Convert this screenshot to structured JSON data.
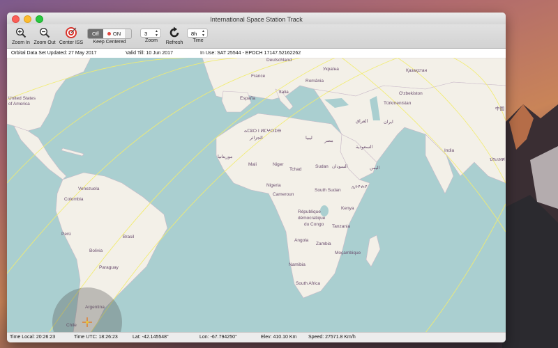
{
  "window": {
    "title": "International Space Station Track"
  },
  "toolbar": {
    "zoom_in_label": "Zoom In",
    "zoom_out_label": "Zoom Out",
    "center_label": "Center ISS",
    "keep_centered": {
      "label": "Keep Centered",
      "off": "Off",
      "on": "ON"
    },
    "zoom": {
      "label": "Zoom",
      "value": "3"
    },
    "refresh_label": "Refresh",
    "time": {
      "label": "Time",
      "value": "8h"
    }
  },
  "infobar": {
    "updated": "Orbital Data Set Updated:  27 May 2017",
    "valid": "Valid Till:  10 Jun 2017",
    "in_use": "In Use:  SAT 25544   -   EPOCH 17147.52162262"
  },
  "map": {
    "labels": [
      "Deutschland",
      "Україна",
      "Қазақстан",
      "France",
      "România",
      "United States",
      "of America",
      "Italia",
      "España",
      "O'zbekiston",
      "Türkmenistan",
      "ⴰⵎⵓⵔ ⵏ ⵍⵎⵖⵔⵉⴱ",
      "الجزائر",
      "ليبيا",
      "مصر",
      "العراق",
      "ایران",
      "السعودية",
      "India",
      "Mali",
      "Niger",
      "Tchad",
      "Sudan",
      "السودان",
      "اليمن",
      "Nigeria",
      "Cameroun",
      "South Sudan",
      "ኢትዮጵያ",
      "Venezuela",
      "Colombia",
      "République",
      "démocratique",
      "du Congo",
      "Kenya",
      "Tanzania",
      "Perú",
      "Brasil",
      "Angola",
      "Zambia",
      "Bolivia",
      "Moçambique",
      "Namibia",
      "Paraguay",
      "South Africa",
      "Argentina",
      "Chile",
      "موريتانيا",
      "中国",
      "ประเทศ"
    ]
  },
  "status": {
    "time_local": "Time Local: 20:26:23",
    "time_utc": "Time UTC: 18:26:23",
    "lat": "Lat:  -42.145548°",
    "lon": "Lon:  -67.794250°",
    "elev": "Elev:  410.10 Km",
    "speed": "Speed:  27571.8 Km/h"
  }
}
